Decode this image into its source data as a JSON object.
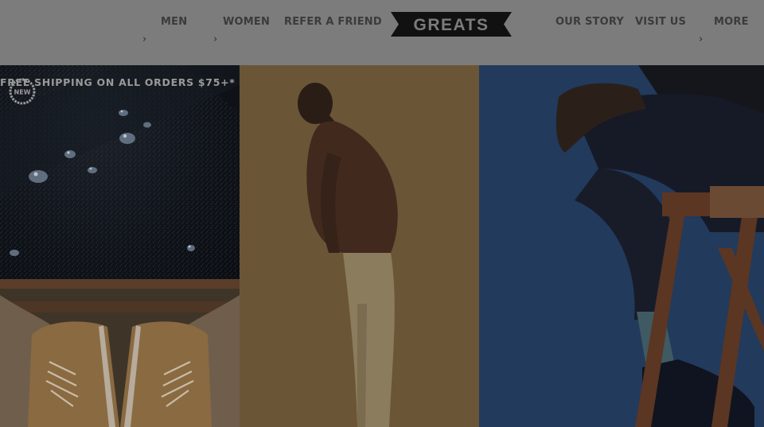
{
  "nav": {
    "left": [
      {
        "label": "MEN"
      },
      {
        "label": "WOMEN"
      },
      {
        "label": "REFER A FRIEND"
      }
    ],
    "right": [
      {
        "label": "OUR STORY"
      },
      {
        "label": "VISIT US"
      },
      {
        "label": "MORE"
      }
    ],
    "chevron": "›"
  },
  "logo": {
    "text": "GREATS"
  },
  "promo": {
    "text": "FREE SHIPPING ON ALL ORDERS $75+*"
  },
  "badge": {
    "text": "NEW"
  },
  "colors": {
    "header_bg": "#7c7c7c",
    "nav_text": "#3b3b3b",
    "logo_bg": "#111111",
    "promo_text": "#9a9a9a"
  },
  "icons": [
    "chevron-right-icon",
    "new-badge-icon"
  ]
}
